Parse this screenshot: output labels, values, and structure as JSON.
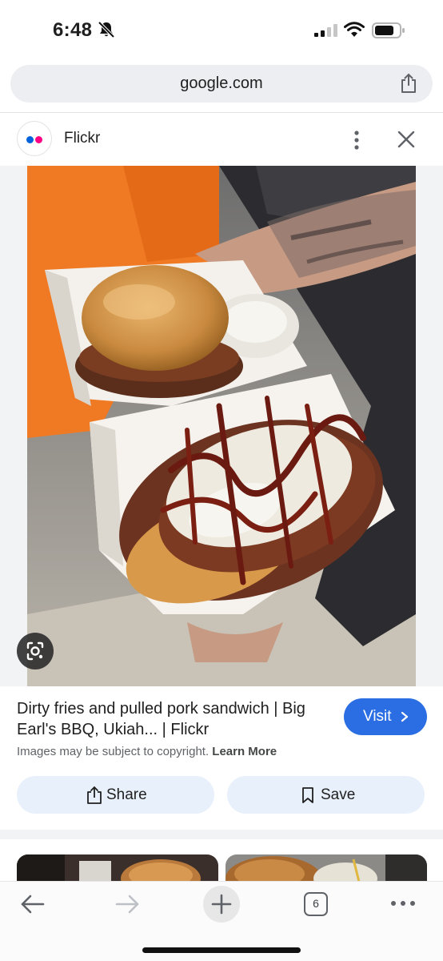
{
  "status_bar": {
    "time": "6:48",
    "icons": [
      "bell-slash-icon",
      "cellular-signal-icon",
      "wifi-icon",
      "battery-icon"
    ]
  },
  "browser": {
    "url": "google.com"
  },
  "source": {
    "name": "Flickr",
    "logo_colors": [
      "#0063dc",
      "#ff0084"
    ]
  },
  "result": {
    "title": "Dirty fries and pulled pork sandwich | Big Earl's BBQ, Ukiah... | Flickr",
    "visit_label": "Visit",
    "copyright_text": "Images may be subject to copyright.",
    "learn_more": "Learn More",
    "share_label": "Share",
    "save_label": "Save"
  },
  "toolbar": {
    "tab_count": "6"
  },
  "colors": {
    "accent": "#2b6ee3",
    "action_bg": "#e8f0fc"
  }
}
